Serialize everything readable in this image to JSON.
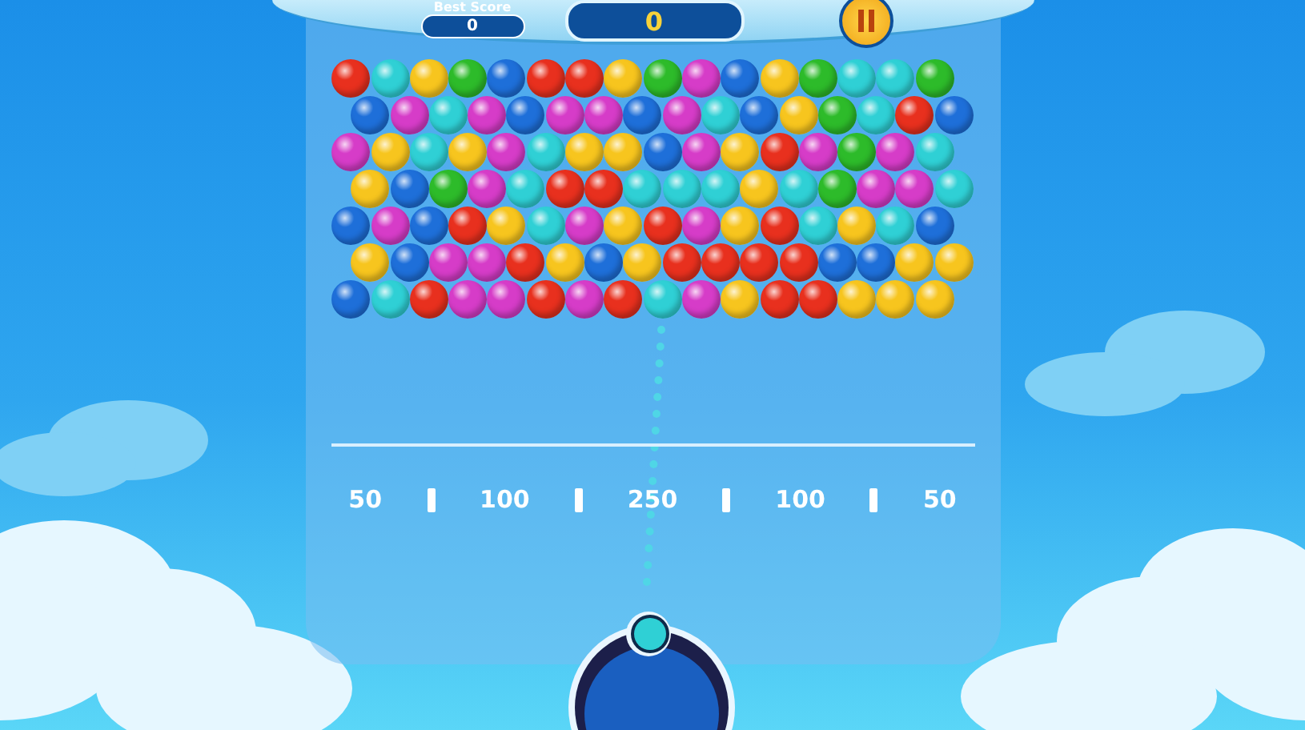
{
  "header": {
    "best_score": {
      "label": "Best Score",
      "value": "0"
    },
    "score": "0"
  },
  "board": {
    "rows": [
      {
        "bubbles": [
          {
            "color": "#e8301e"
          },
          {
            "color": "#2fd0d5"
          },
          {
            "color": "#f7c51e"
          },
          {
            "color": "#2dbb2a"
          },
          {
            "color": "#1e6fd9"
          },
          {
            "color": "#e8301e"
          },
          {
            "color": "#e8301e"
          },
          {
            "color": "#f7c51e"
          },
          {
            "color": "#2dbb2a"
          },
          {
            "color": "#d63cc8"
          },
          {
            "color": "#1e6fd9"
          },
          {
            "color": "#f7c51e"
          },
          {
            "color": "#2dbb2a"
          },
          {
            "color": "#2fd0d5"
          },
          {
            "color": "#2fd0d5"
          },
          {
            "color": "#2dbb2a"
          }
        ]
      },
      {
        "bubbles": [
          {
            "color": "#1e6fd9"
          },
          {
            "color": "#d63cc8"
          },
          {
            "color": "#2fd0d5"
          },
          {
            "color": "#d63cc8"
          },
          {
            "color": "#1e6fd9"
          },
          {
            "color": "#d63cc8"
          },
          {
            "color": "#d63cc8"
          },
          {
            "color": "#1e6fd9"
          },
          {
            "color": "#d63cc8"
          },
          {
            "color": "#2fd0d5"
          },
          {
            "color": "#1e6fd9"
          },
          {
            "color": "#f7c51e"
          },
          {
            "color": "#2dbb2a"
          },
          {
            "color": "#2fd0d5"
          },
          {
            "color": "#e8301e"
          },
          {
            "color": "#1e6fd9"
          }
        ]
      },
      {
        "bubbles": [
          {
            "color": "#d63cc8"
          },
          {
            "color": "#f7c51e"
          },
          {
            "color": "#2fd0d5"
          },
          {
            "color": "#f7c51e"
          },
          {
            "color": "#d63cc8"
          },
          {
            "color": "#2fd0d5"
          },
          {
            "color": "#f7c51e"
          },
          {
            "color": "#f7c51e"
          },
          {
            "color": "#1e6fd9"
          },
          {
            "color": "#d63cc8"
          },
          {
            "color": "#f7c51e"
          },
          {
            "color": "#e8301e"
          },
          {
            "color": "#d63cc8"
          },
          {
            "color": "#2dbb2a"
          },
          {
            "color": "#d63cc8"
          },
          {
            "color": "#2fd0d5"
          }
        ]
      },
      {
        "bubbles": [
          {
            "color": "#f7c51e"
          },
          {
            "color": "#1e6fd9"
          },
          {
            "color": "#2dbb2a"
          },
          {
            "color": "#d63cc8"
          },
          {
            "color": "#2fd0d5"
          },
          {
            "color": "#e8301e"
          },
          {
            "color": "#e8301e"
          },
          {
            "color": "#2fd0d5"
          },
          {
            "color": "#2fd0d5"
          },
          {
            "color": "#2fd0d5"
          },
          {
            "color": "#f7c51e"
          },
          {
            "color": "#2fd0d5"
          },
          {
            "color": "#2dbb2a"
          },
          {
            "color": "#d63cc8"
          },
          {
            "color": "#d63cc8"
          },
          {
            "color": "#2fd0d5"
          }
        ]
      },
      {
        "bubbles": [
          {
            "color": "#1e6fd9"
          },
          {
            "color": "#d63cc8"
          },
          {
            "color": "#1e6fd9"
          },
          {
            "color": "#e8301e"
          },
          {
            "color": "#f7c51e"
          },
          {
            "color": "#2fd0d5"
          },
          {
            "color": "#d63cc8"
          },
          {
            "color": "#f7c51e"
          },
          {
            "color": "#e8301e"
          },
          {
            "color": "#d63cc8"
          },
          {
            "color": "#f7c51e"
          },
          {
            "color": "#e8301e"
          },
          {
            "color": "#2fd0d5"
          },
          {
            "color": "#f7c51e"
          },
          {
            "color": "#2fd0d5"
          },
          {
            "color": "#1e6fd9"
          }
        ]
      },
      {
        "bubbles": [
          {
            "color": "#f7c51e"
          },
          {
            "color": "#1e6fd9"
          },
          {
            "color": "#d63cc8"
          },
          {
            "color": "#d63cc8"
          },
          {
            "color": "#e8301e"
          },
          {
            "color": "#f7c51e"
          },
          {
            "color": "#1e6fd9"
          },
          {
            "color": "#f7c51e"
          },
          {
            "color": "#e8301e"
          },
          {
            "color": "#e8301e"
          },
          {
            "color": "#e8301e"
          },
          {
            "color": "#e8301e"
          },
          {
            "color": "#1e6fd9"
          },
          {
            "color": "#1e6fd9"
          },
          {
            "color": "#f7c51e"
          },
          {
            "color": "#f7c51e"
          }
        ]
      },
      {
        "bubbles": [
          {
            "color": "#1e6fd9"
          },
          {
            "color": "#2fd0d5"
          },
          {
            "color": "#e8301e"
          },
          {
            "color": "#d63cc8"
          },
          {
            "color": "#d63cc8"
          },
          {
            "color": "#e8301e"
          },
          {
            "color": "#d63cc8"
          },
          {
            "color": "#e8301e"
          },
          {
            "color": "#2fd0d5"
          },
          {
            "color": "#d63cc8"
          },
          {
            "color": "#f7c51e"
          },
          {
            "color": "#e8301e"
          },
          {
            "color": "#e8301e"
          },
          {
            "color": "#f7c51e"
          },
          {
            "color": "#f7c51e"
          },
          {
            "color": "#f7c51e"
          }
        ]
      }
    ]
  },
  "score_zones": [
    "50",
    "100",
    "250",
    "100",
    "50"
  ],
  "next_bubble": {
    "color": "#2fd0d5"
  }
}
